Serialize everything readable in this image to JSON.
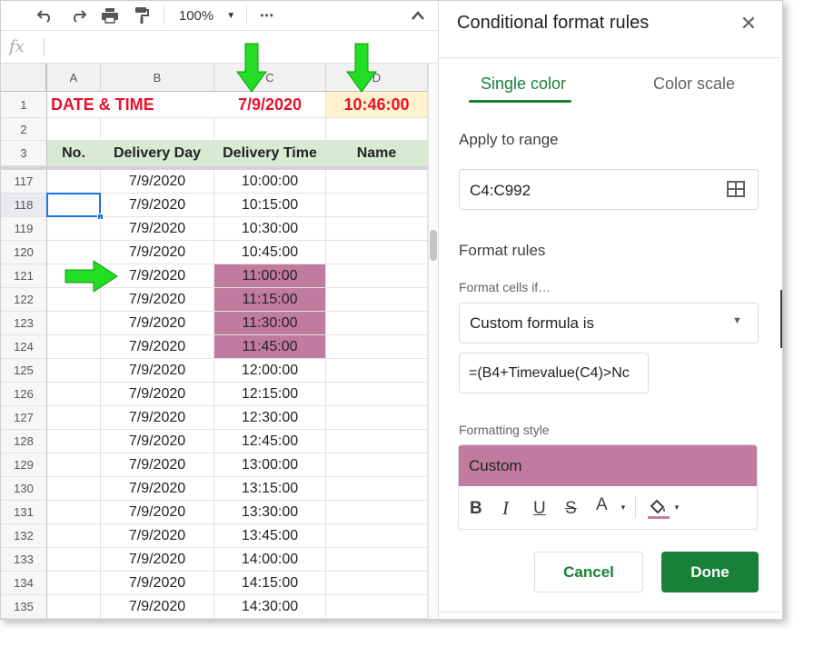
{
  "toolbar": {
    "zoom": "100%",
    "more": "•••"
  },
  "formula_bar": {
    "fx_label": "fx"
  },
  "columns": [
    "A",
    "B",
    "C",
    "D"
  ],
  "top_rows": [
    {
      "num": "1",
      "a": "DATE & TIME",
      "b": "",
      "c": "7/9/2020",
      "d": "10:46:00"
    },
    {
      "num": "2",
      "a": "",
      "b": "",
      "c": "",
      "d": ""
    },
    {
      "num": "3",
      "a": "No.",
      "b": "Delivery Day",
      "c": "Delivery Time",
      "d": "Name"
    }
  ],
  "data_rows": [
    {
      "num": "117",
      "b": "7/9/2020",
      "c": "10:00:00"
    },
    {
      "num": "118",
      "b": "7/9/2020",
      "c": "10:15:00"
    },
    {
      "num": "119",
      "b": "7/9/2020",
      "c": "10:30:00"
    },
    {
      "num": "120",
      "b": "7/9/2020",
      "c": "10:45:00"
    },
    {
      "num": "121",
      "b": "7/9/2020",
      "c": "11:00:00",
      "hl": true
    },
    {
      "num": "122",
      "b": "7/9/2020",
      "c": "11:15:00",
      "hl": true
    },
    {
      "num": "123",
      "b": "7/9/2020",
      "c": "11:30:00",
      "hl": true
    },
    {
      "num": "124",
      "b": "7/9/2020",
      "c": "11:45:00",
      "hl": true
    },
    {
      "num": "125",
      "b": "7/9/2020",
      "c": "12:00:00"
    },
    {
      "num": "126",
      "b": "7/9/2020",
      "c": "12:15:00"
    },
    {
      "num": "127",
      "b": "7/9/2020",
      "c": "12:30:00"
    },
    {
      "num": "128",
      "b": "7/9/2020",
      "c": "12:45:00"
    },
    {
      "num": "129",
      "b": "7/9/2020",
      "c": "13:00:00"
    },
    {
      "num": "130",
      "b": "7/9/2020",
      "c": "13:15:00"
    },
    {
      "num": "131",
      "b": "7/9/2020",
      "c": "13:30:00"
    },
    {
      "num": "132",
      "b": "7/9/2020",
      "c": "13:45:00"
    },
    {
      "num": "133",
      "b": "7/9/2020",
      "c": "14:00:00"
    },
    {
      "num": "134",
      "b": "7/9/2020",
      "c": "14:15:00"
    },
    {
      "num": "135",
      "b": "7/9/2020",
      "c": "14:30:00"
    }
  ],
  "panel": {
    "title": "Conditional format rules",
    "tab_single": "Single color",
    "tab_scale": "Color scale",
    "apply_to_range_label": "Apply to range",
    "range_value": "C4:C992",
    "format_rules_label": "Format rules",
    "format_cells_if_label": "Format cells if…",
    "condition_value": "Custom formula is",
    "formula_value": "=(B4+Timevalue(C4)>Nc",
    "formatting_style_label": "Formatting style",
    "style_preview": "Custom",
    "cancel_label": "Cancel",
    "done_label": "Done"
  },
  "colors": {
    "highlight": "#c27ba0",
    "header_green": "#d9ead3",
    "title_red": "#e8112d",
    "date_bg": "#fff2cc",
    "accent_green": "#188038",
    "arrow_green": "#22dd22"
  }
}
